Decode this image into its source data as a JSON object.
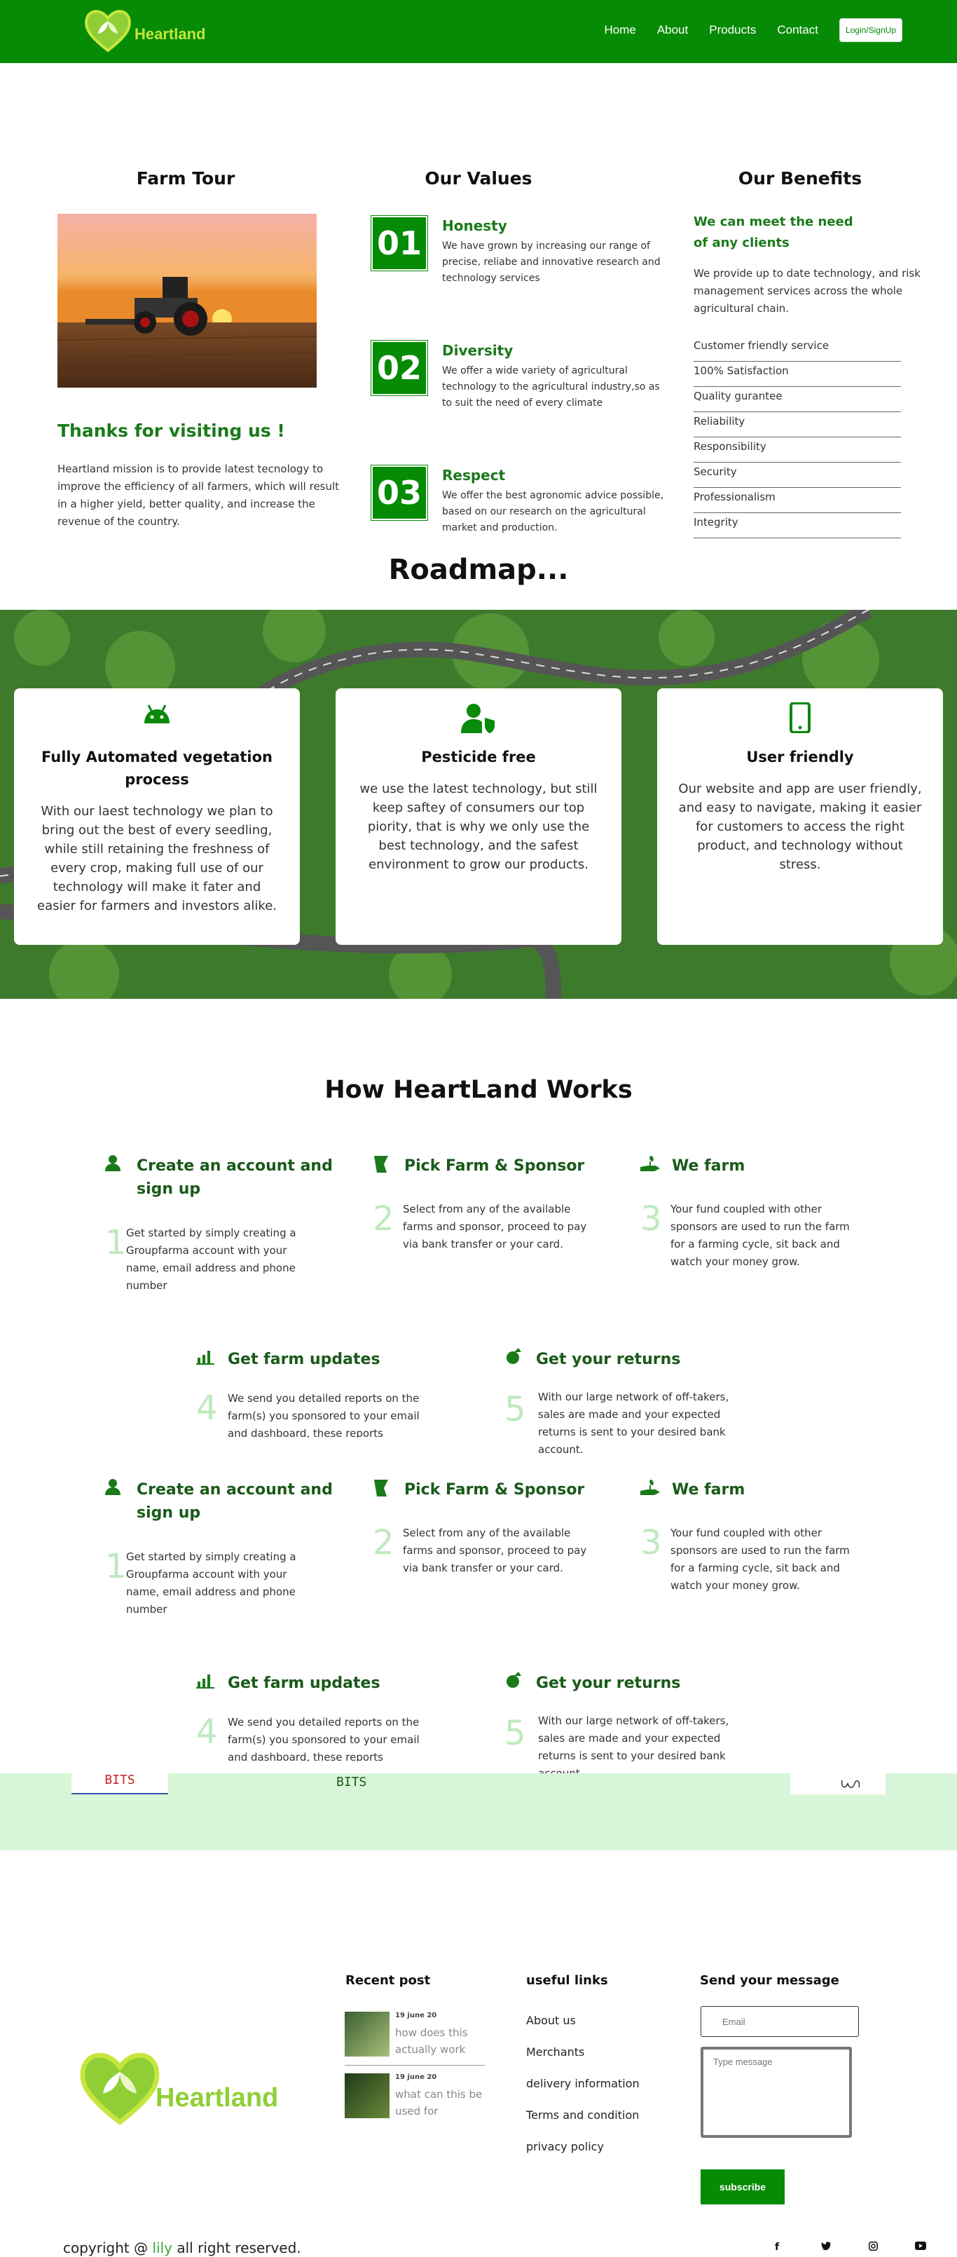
{
  "nav": {
    "logo_text": "Heartland",
    "links": [
      "Home",
      "About",
      "Products",
      "Contact"
    ],
    "login": "Login/SignUp"
  },
  "farm": {
    "title": "Farm Tour",
    "thanks": "Thanks for visiting us !",
    "mission": "Heartland mission is to provide latest tecnology to improve the efficiency of all farmers, which will result in a higher yield, better quality, and increase the revenue of the country."
  },
  "values": {
    "title": "Our Values",
    "items": [
      {
        "num": "01",
        "title": "Honesty",
        "text": "We have grown by increasing our range of precise, reliabe and innovative research and technology services"
      },
      {
        "num": "02",
        "title": "Diversity",
        "text": "We offer a wide variety of agricultural technology to the agricultural industry,so as to suit the need of every climate"
      },
      {
        "num": "03",
        "title": "Respect",
        "text": "We offer the best agronomic advice possible, based on our research on the agricultural market and production."
      }
    ]
  },
  "benefits": {
    "title": "Our Benefits",
    "heading": "We can meet the need of any clients",
    "text": "We provide up to date technology, and risk management services across the whole agricultural chain.",
    "list": [
      "Customer friendly service",
      "100% Satisfaction",
      "Quality gurantee",
      "Reliability",
      "Responsibility",
      "Security",
      "Professionalism",
      "Integrity"
    ]
  },
  "roadmap": {
    "title": "Roadmap...",
    "cards": [
      {
        "icon": "android-icon",
        "title": "Fully Automated vegetation process",
        "text": "With our laest technology we plan to bring out the best of every seedling, while still retaining the freshness of every crop, making full use of our technology will make it fater and easier for farmers and investors alike."
      },
      {
        "icon": "user-shield-icon",
        "title": "Pesticide free",
        "text": "we use the latest technology, but still keep saftey of consumers our top piority, that is why we only use the best technology, and the safest environment to grow our products."
      },
      {
        "icon": "mobile-phone-icon",
        "title": "User friendly",
        "text": "Our website and app are user friendly, and easy to navigate, making it easier for customers to access the right product, and technology without stress."
      }
    ]
  },
  "how": {
    "title": "How HeartLand Works",
    "steps": [
      {
        "icon": "user-icon",
        "title": "Create an account and sign up",
        "num": "1",
        "text": "Get started by simply creating a Groupfarma account with your name, email address and phone number"
      },
      {
        "icon": "farm-sack-icon",
        "title": "Pick Farm & Sponsor",
        "num": "2",
        "text": "Select from any of the available farms and sponsor, proceed to pay via bank transfer or your card."
      },
      {
        "icon": "hand-seedling-icon",
        "title": "We farm",
        "num": "3",
        "text": "Your fund coupled with other sponsors are used to run the farm for a farming cycle, sit back and watch your money grow."
      },
      {
        "icon": "chart-bars-icon",
        "title": "Get farm updates",
        "num": "4",
        "text": "We send you detailed reports on the farm(s) you sponsored to your email and dashboard, these reports include farms'"
      },
      {
        "icon": "money-bag-icon",
        "title": "Get your returns",
        "num": "5",
        "text": "With our large network of off-takers, sales are made and your expected returns is sent to your desired bank account."
      }
    ],
    "band_labels": [
      "BITS",
      "BITS"
    ]
  },
  "footer": {
    "logo_text": "Heartland",
    "recent_title": "Recent post",
    "posts": [
      {
        "date": "19 june 20",
        "text": "how does this actually work"
      },
      {
        "date": "19 june 20",
        "text": "what can this be used for"
      }
    ],
    "links_title": "useful links",
    "links": [
      "About us",
      "Merchants",
      "delivery information",
      "Terms and condition",
      "privacy policy"
    ],
    "message_title": "Send your message",
    "email_placeholder": "Email",
    "message_placeholder": "Type message",
    "subscribe": "subscribe",
    "copyright_pre": "copyright @",
    "copyright_name": "lily",
    "copyright_post": "all right reserved.",
    "social": [
      "f",
      "t",
      "i",
      "y"
    ]
  },
  "colors": {
    "brand": "#058b05",
    "accent": "#c5e63d",
    "band": "#d9f5d8"
  }
}
